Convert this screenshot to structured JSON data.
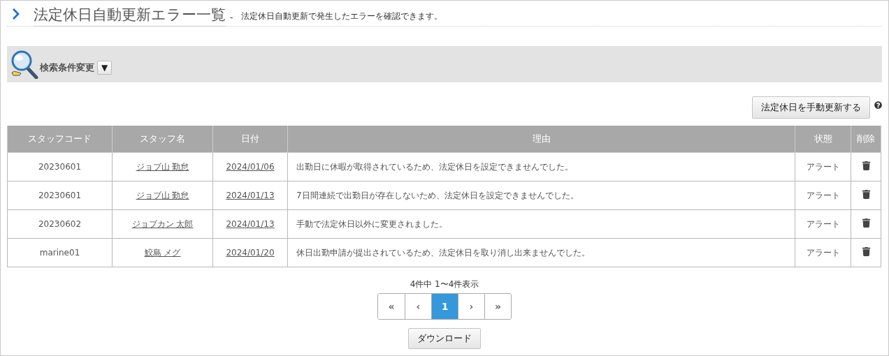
{
  "header": {
    "title": "法定休日自動更新エラー一覧",
    "separator": "-",
    "description": "法定休日自動更新で発生したエラーを確認できます。"
  },
  "search_panel": {
    "label": "検索条件変更",
    "toggle": "▼"
  },
  "update_button": "法定休日を手動更新する",
  "table": {
    "columns": [
      "スタッフコード",
      "スタッフ名",
      "日付",
      "理由",
      "状態",
      "削除"
    ],
    "rows": [
      {
        "code": "20230601",
        "name": "ジョブ山 勤怠",
        "date": "2024/01/06",
        "reason": "出勤日に休暇が取得されているため、法定休日を設定できませんでした。",
        "status": "アラート"
      },
      {
        "code": "20230601",
        "name": "ジョブ山 勤怠",
        "date": "2024/01/13",
        "reason": "7日間連続で出勤日が存在しないため、法定休日を設定できませんでした。",
        "status": "アラート"
      },
      {
        "code": "20230602",
        "name": "ジョブカン 太郎",
        "date": "2024/01/13",
        "reason": "手動で法定休日以外に変更されました。",
        "status": "アラート"
      },
      {
        "code": "marine01",
        "name": "鮫島 メグ",
        "date": "2024/01/20",
        "reason": "休日出勤申請が提出されているため、法定休日を取り消し出来ませんでした。",
        "status": "アラート"
      }
    ]
  },
  "pagination": {
    "summary": "4件中 1〜4件表示",
    "pages": [
      {
        "label": "«",
        "selected": false
      },
      {
        "label": "‹",
        "selected": false
      },
      {
        "label": "1",
        "selected": true
      },
      {
        "label": "›",
        "selected": false
      },
      {
        "label": "»",
        "selected": false
      }
    ]
  },
  "download_button": "ダウンロード"
}
